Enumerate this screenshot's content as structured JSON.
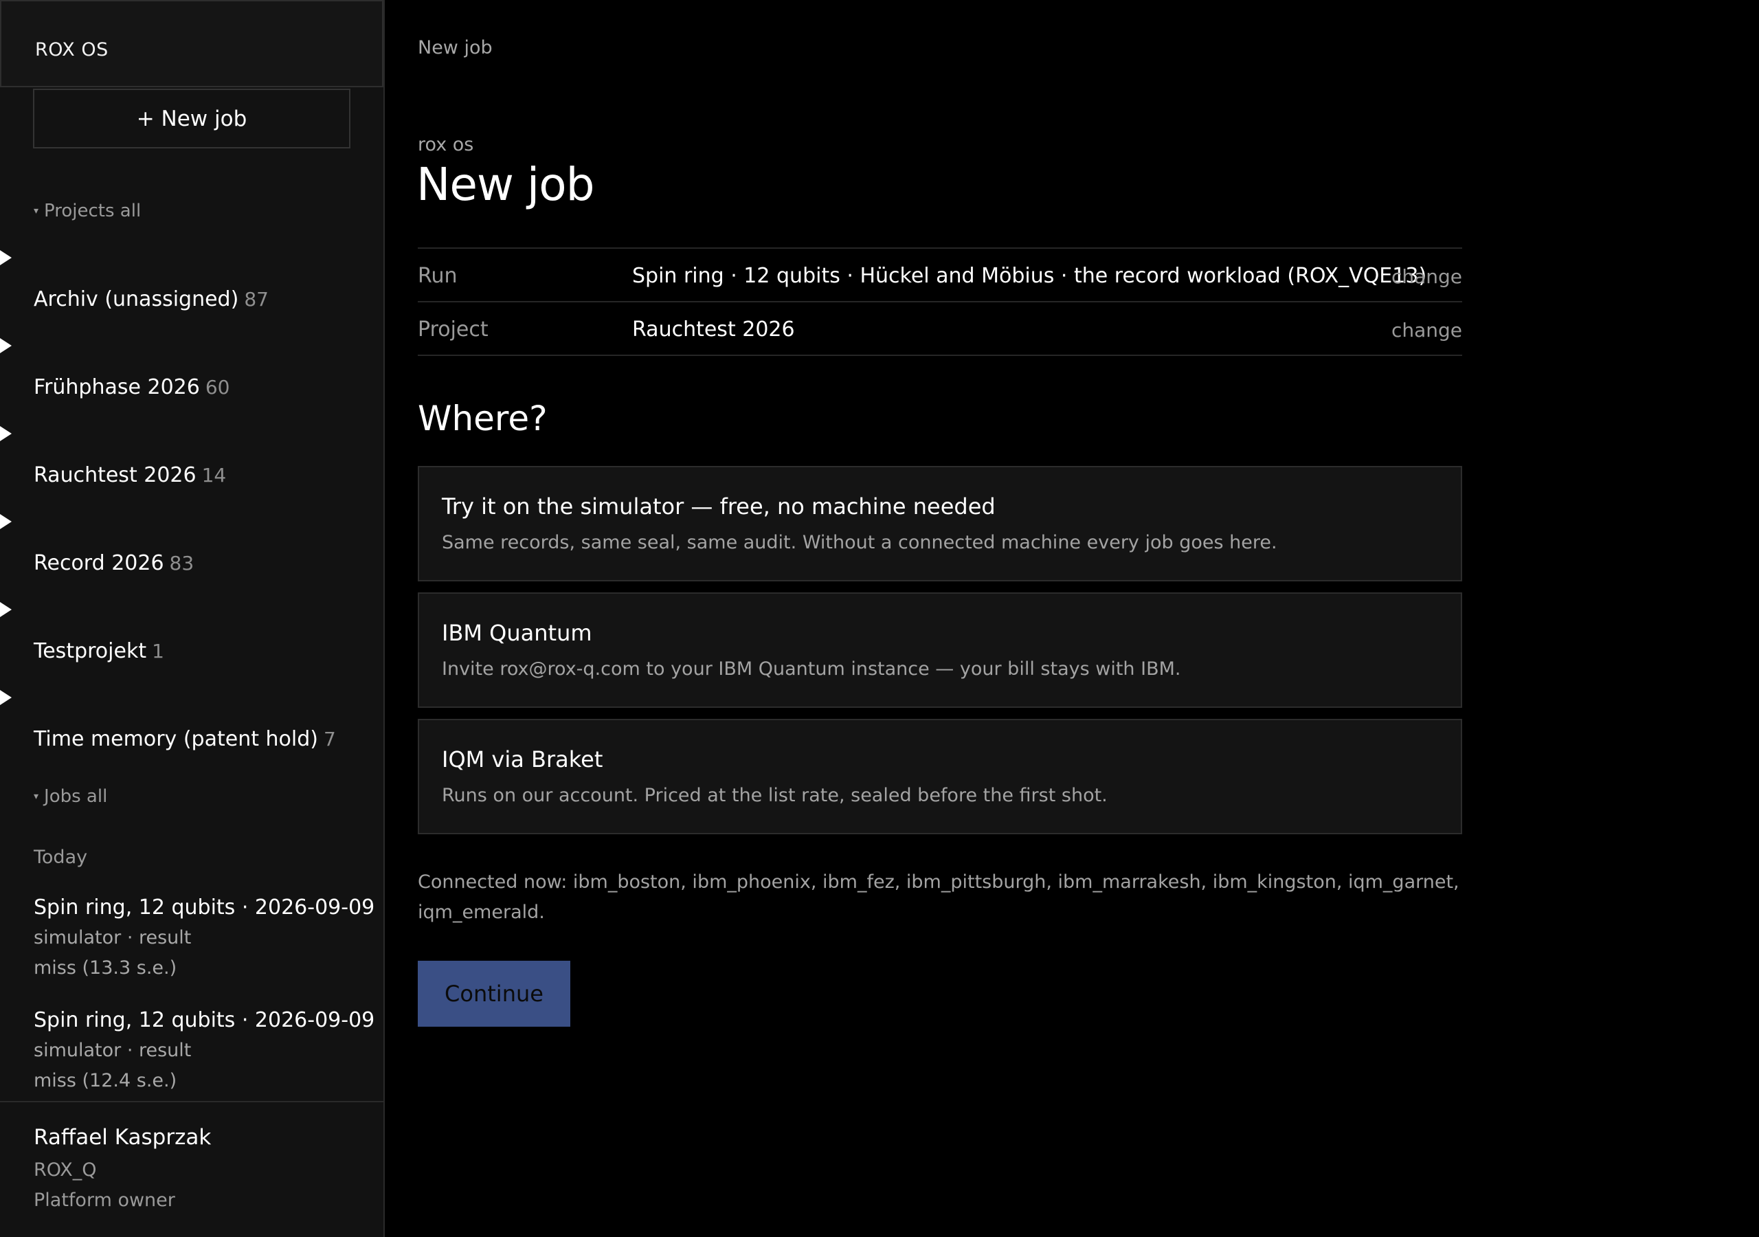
{
  "app": {
    "brand": "ROX OS"
  },
  "sidebar": {
    "new_job_label": "+ New job",
    "projects_toggle": "Projects all",
    "projects": [
      {
        "name": "Archiv (unassigned)",
        "count": "87"
      },
      {
        "name": "Frühphase 2026",
        "count": "60"
      },
      {
        "name": "Rauchtest 2026",
        "count": "14"
      },
      {
        "name": "Record 2026",
        "count": "83"
      },
      {
        "name": "Testprojekt",
        "count": "1"
      },
      {
        "name": "Time memory (patent hold)",
        "count": "7"
      }
    ],
    "jobs_toggle": "Jobs all",
    "group_today": "Today",
    "jobs": [
      {
        "title": "Spin ring, 12 qubits · 2026-09-09",
        "meta1": "simulator · result",
        "meta2": "miss (13.3 s.e.)"
      },
      {
        "title": "Spin ring, 12 qubits · 2026-09-09",
        "meta1": "simulator · result",
        "meta2": "miss (12.4 s.e.)"
      }
    ],
    "user": {
      "name": "Raffael Kasprzak",
      "org": "ROX_Q",
      "role": "Platform owner"
    }
  },
  "main": {
    "breadcrumb": "New job",
    "eyebrow": "rox os",
    "title": "New job",
    "summary": [
      {
        "label": "Run",
        "value": "Spin ring · 12 qubits · Hückel and Möbius · the record workload (ROX_VQE13)",
        "action": "change"
      },
      {
        "label": "Project",
        "value": "Rauchtest 2026",
        "action": "change"
      }
    ],
    "where_heading": "Where?",
    "options": [
      {
        "title": "Try it on the simulator — free, no machine needed",
        "desc": "Same records, same seal, same audit. Without a connected machine every job goes here."
      },
      {
        "title": "IBM Quantum",
        "desc": "Invite rox@rox-q.com to your IBM Quantum instance — your bill stays with IBM."
      },
      {
        "title": "IQM via Braket",
        "desc": "Runs on our account. Priced at the list rate, sealed before the first shot."
      }
    ],
    "connected": "Connected now: ibm_boston, ibm_phoenix, ibm_fez, ibm_pittsburgh, ibm_marrakesh, ibm_kingston, iqm_garnet, iqm_emerald.",
    "continue_label": "Continue"
  },
  "colors": {
    "background": "#000000",
    "sidebar": "#121212",
    "card": "#141414",
    "accent_button": "#3a4f85",
    "muted_text": "#a3a3a3"
  },
  "icons": {
    "expand": "caret-right-icon",
    "collapse": "caret-down-icon"
  }
}
